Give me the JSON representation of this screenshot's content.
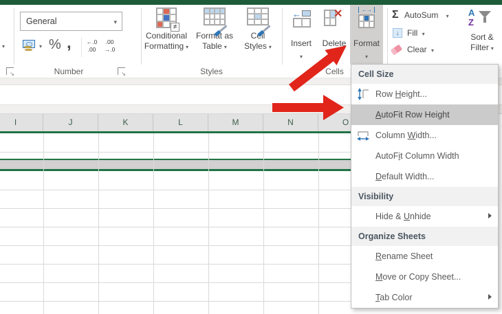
{
  "ribbon": {
    "number": {
      "value": "General",
      "group_label": "Number",
      "percent_label": "%",
      "comma_label": ",",
      "inc_decimal_top": "←.0",
      "inc_decimal_bottom": ".00",
      "dec_decimal_top": ".00",
      "dec_decimal_bottom": "→.0"
    },
    "styles": {
      "group_label": "Styles",
      "conditional_line1": "Conditional",
      "conditional_line2": "Formatting",
      "format_table_line1": "Format as",
      "format_table_line2": "Table",
      "cell_styles_line1": "Cell",
      "cell_styles_line2": "Styles",
      "neq_glyph": "≠"
    },
    "cells": {
      "group_label": "Cells",
      "insert_label": "Insert",
      "delete_label": "Delete",
      "format_label": "Format"
    },
    "editing": {
      "autosum_label": "AutoSum",
      "sigma_glyph": "Σ",
      "fill_label": "Fill",
      "fill_arrow_glyph": "↓",
      "clear_label": "Clear",
      "sort_line1": "Sort &",
      "sort_line2": "Filter",
      "sort_a_glyph": "A",
      "sort_z_glyph": "Z",
      "delete_x_glyph": "✕",
      "insert_arrow_glyph": "←",
      "format_arrow_glyph": "←→"
    }
  },
  "sheet": {
    "columns": [
      "I",
      "J",
      "K",
      "L",
      "M",
      "N",
      "O"
    ]
  },
  "menu": {
    "sections": [
      {
        "header": "Cell Size",
        "items": [
          {
            "label": "Row Height...",
            "accel": 4,
            "icon": "row-height",
            "highlight": false,
            "submenu": false
          },
          {
            "label": "AutoFit Row Height",
            "accel": 0,
            "icon": "",
            "highlight": true,
            "submenu": false
          },
          {
            "label": "Column Width...",
            "accel": 7,
            "icon": "column-width",
            "highlight": false,
            "submenu": false
          },
          {
            "label": "AutoFit Column Width",
            "accel": 5,
            "icon": "",
            "highlight": false,
            "submenu": false
          },
          {
            "label": "Default Width...",
            "accel": 0,
            "icon": "",
            "highlight": false,
            "submenu": false
          }
        ]
      },
      {
        "header": "Visibility",
        "items": [
          {
            "label": "Hide & Unhide",
            "accel": 7,
            "icon": "",
            "highlight": false,
            "submenu": true
          }
        ]
      },
      {
        "header": "Organize Sheets",
        "items": [
          {
            "label": "Rename Sheet",
            "accel": 0,
            "icon": "",
            "highlight": false,
            "submenu": false
          },
          {
            "label": "Move or Copy Sheet...",
            "accel": 0,
            "icon": "",
            "highlight": false,
            "submenu": false
          },
          {
            "label": "Tab Color",
            "accel": 0,
            "icon": "",
            "highlight": false,
            "submenu": true
          }
        ]
      }
    ]
  },
  "colors": {
    "excel_green": "#217346",
    "titlebar_green": "#1d5c38",
    "arrow_red": "#e1251b",
    "menu_highlight": "#cbcbcb",
    "pressed_button_gray": "#d2d0ce",
    "accent_blue": "#2e75b6"
  }
}
